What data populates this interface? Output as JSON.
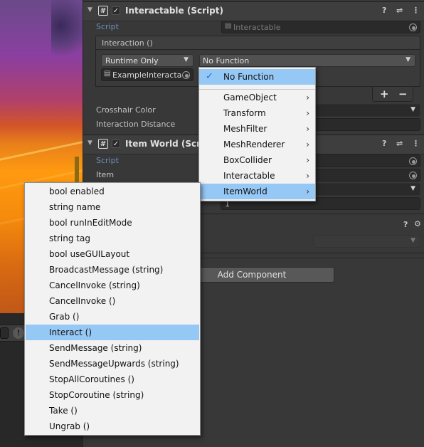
{
  "interactable_component": {
    "title": "Interactable (Script)",
    "script_label": "Script",
    "script_value": "Interactable",
    "event_header": "Interaction ()",
    "runtime_mode": "Runtime Only",
    "function_value": "No Function",
    "target_object": "ExampleInteracta",
    "plus": "+",
    "minus": "−",
    "crosshair_label": "Crosshair Color",
    "distance_label": "Interaction Distance",
    "help_icon": "?",
    "settings_icon": "⇌",
    "more_icon": "⋮",
    "check": "✓",
    "fold": "▼"
  },
  "item_world_component": {
    "title": "Item World (Scri",
    "script_label": "Script",
    "item_label": "Item",
    "amount_value": "1",
    "help_icon": "?",
    "settings_icon": "⇌",
    "more_icon": "⋮",
    "check": "✓",
    "fold": "▼"
  },
  "third_component": {
    "help_icon": "?",
    "settings_icon": "⚙"
  },
  "add_component_label": "Add Component",
  "console_warning_icon": "!",
  "function_menu": {
    "checked_item": "No Function",
    "check_glyph": "✓",
    "items": [
      {
        "label": "GameObject",
        "chev": "›"
      },
      {
        "label": "Transform",
        "chev": "›"
      },
      {
        "label": "MeshFilter",
        "chev": "›"
      },
      {
        "label": "MeshRenderer",
        "chev": "›"
      },
      {
        "label": "BoxCollider",
        "chev": "›"
      },
      {
        "label": "Interactable",
        "chev": "›"
      },
      {
        "label": "ItemWorld",
        "chev": "›"
      }
    ],
    "highlighted": "ItemWorld"
  },
  "submenu": {
    "items": [
      "bool enabled",
      "string name",
      "bool runInEditMode",
      "string tag",
      "bool useGUILayout",
      "BroadcastMessage (string)",
      "CancelInvoke (string)",
      "CancelInvoke ()",
      "Grab ()",
      "Interact ()",
      "SendMessage (string)",
      "SendMessageUpwards (string)",
      "StopAllCoroutines ()",
      "StopCoroutine (string)",
      "Take ()",
      "Ungrab ()"
    ],
    "highlighted": "Interact ()"
  },
  "colors": {
    "inspector_bg": "#383838",
    "menu_bg": "#f2f2f2",
    "menu_highlight": "#96c8f6",
    "label_blue": "#6c8fb8"
  }
}
